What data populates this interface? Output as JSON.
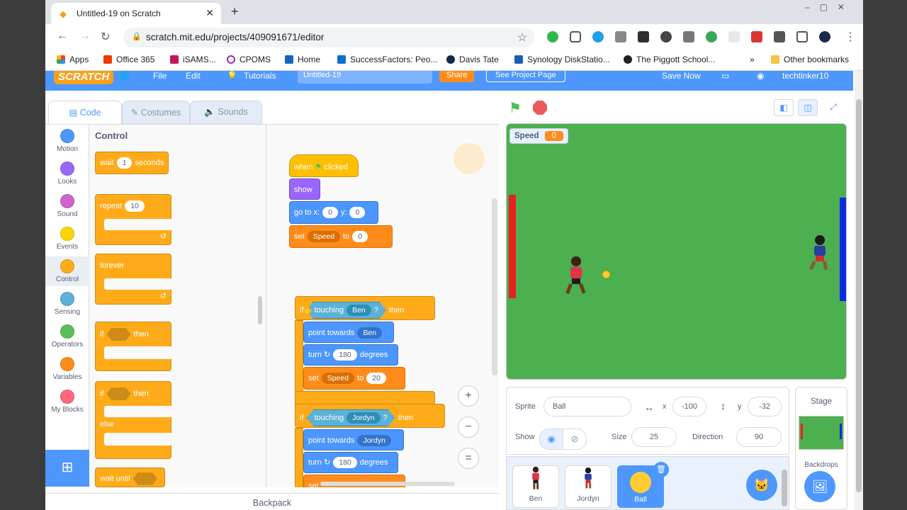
{
  "browser": {
    "tab_title": "Untitled-19 on Scratch",
    "url": "scratch.mit.edu/projects/409091671/editor",
    "bookmarks": [
      "Apps",
      "Office 365",
      "iSAMS...",
      "CPOMS",
      "Home",
      "SuccessFactors: Peo...",
      "Davis Tate",
      "Synology DiskStatio...",
      "The Piggott School...",
      "Other bookmarks"
    ],
    "more": "»"
  },
  "menu": {
    "logo": "SCRATCH",
    "file": "File",
    "edit": "Edit",
    "tutorials": "Tutorials",
    "title": "Untitled-19",
    "share": "Share",
    "see_project": "See Project Page",
    "save_now": "Save Now",
    "user": "techtinker10"
  },
  "editor_tabs": {
    "code": "Code",
    "costumes": "Costumes",
    "sounds": "Sounds"
  },
  "categories": [
    {
      "label": "Motion",
      "color": "#4c97ff"
    },
    {
      "label": "Looks",
      "color": "#9966ff"
    },
    {
      "label": "Sound",
      "color": "#cf63cf"
    },
    {
      "label": "Events",
      "color": "#ffd500"
    },
    {
      "label": "Control",
      "color": "#ffab19"
    },
    {
      "label": "Sensing",
      "color": "#5cb1d6"
    },
    {
      "label": "Operators",
      "color": "#59c059"
    },
    {
      "label": "Variables",
      "color": "#ff8c1a"
    },
    {
      "label": "My Blocks",
      "color": "#ff6680"
    }
  ],
  "palette": {
    "heading": "Control",
    "wait": "wait",
    "wait_val": "1",
    "seconds": "seconds",
    "repeat": "repeat",
    "repeat_val": "10",
    "forever": "forever",
    "if": "if",
    "then": "then",
    "else": "else",
    "wait_until": "wait until"
  },
  "script": {
    "when": "when",
    "clicked": "clicked",
    "show": "show",
    "goto": "go to x:",
    "x_val": "0",
    "y_label": "y:",
    "y_val": "0",
    "set": "set",
    "var": "Speed",
    "to": "to",
    "set_val": "0",
    "if": "if",
    "touching": "touching",
    "ben": "Ben",
    "q": "?",
    "then": "then",
    "point_towards": "point towards",
    "turn": "turn",
    "deg_val": "180",
    "degrees": "degrees",
    "set_val2": "20",
    "jordyn": "Jordyn"
  },
  "zoom": {
    "in": "+",
    "out": "−",
    "reset": "="
  },
  "backpack": "Backpack",
  "stage": {
    "monitor_label": "Speed",
    "monitor_value": "0",
    "left_paddle_color": "#e8211f",
    "right_paddle_color": "#0a2be0",
    "bg_color": "#4caf50"
  },
  "sprite_info": {
    "sprite_label": "Sprite",
    "sprite_name": "Ball",
    "x_label": "x",
    "x_val": "-100",
    "y_label": "y",
    "y_val": "-32",
    "show_label": "Show",
    "size_label": "Size",
    "size_val": "25",
    "direction_label": "Direction",
    "direction_val": "90"
  },
  "sprites": [
    {
      "name": "Ben"
    },
    {
      "name": "Jordyn"
    },
    {
      "name": "Ball"
    }
  ],
  "stage_pane": {
    "title": "Stage",
    "backdrops": "Backdrops"
  }
}
